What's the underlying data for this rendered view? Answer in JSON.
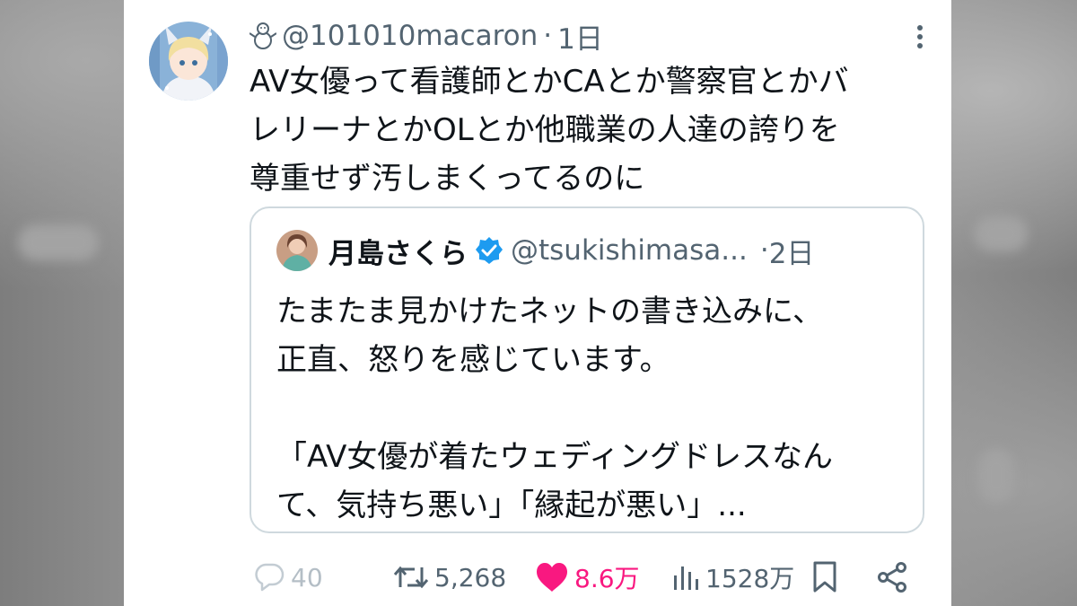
{
  "tweet": {
    "handle": "@101010macaron",
    "separator": "·",
    "time": "1日",
    "text": "AV女優って看護師とかCAとか警察官とかバ\nレリーナとかOLとか他職業の人達の誇りを\n尊重せず汚しまくってるのに"
  },
  "quote": {
    "name": "月島さくら",
    "handle": "@tsukishimasa...",
    "separator": "·",
    "time": "2日",
    "text": "たまたま見かけたネットの書き込みに、\n正直、怒りを感じています。\n\n「AV女優が着たウェディングドレスなん\nて、気持ち悪い」「縁起が悪い」..."
  },
  "actions": {
    "replies": "40",
    "retweets": "5,268",
    "likes": "8.6万",
    "views": "1528万"
  },
  "colors": {
    "text": "#0f1419",
    "secondary": "#536471",
    "like": "#f91880",
    "verified": "#1d9bf0",
    "border": "#cfd9de"
  },
  "icons": [
    "snowman-icon",
    "more-icon",
    "verified-badge-icon",
    "reply-icon",
    "retweet-icon",
    "like-icon",
    "views-icon",
    "bookmark-icon",
    "share-icon"
  ]
}
